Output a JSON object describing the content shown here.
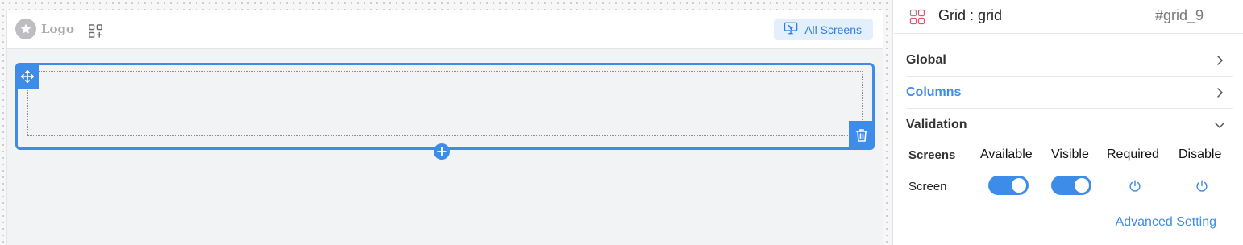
{
  "canvas": {
    "logo_text": "Logo",
    "all_screens_label": "All Screens"
  },
  "panel": {
    "title": "Grid : grid",
    "element_id": "#grid_9",
    "sections": [
      {
        "label": "Global",
        "state": "collapsed",
        "color": "#333333"
      },
      {
        "label": "Columns",
        "state": "collapsed",
        "color": "#3d8ce8"
      },
      {
        "label": "Validation",
        "state": "expanded",
        "color": "#333333"
      }
    ],
    "validation": {
      "headers": [
        "Screens",
        "Available",
        "Visible",
        "Required",
        "Disable"
      ],
      "rows": [
        {
          "screen": "Screen",
          "available": true,
          "visible": true,
          "required": false,
          "disable": false
        }
      ]
    },
    "advanced_setting_label": "Advanced Setting"
  },
  "colors": {
    "accent": "#3d8ce8",
    "accent_light": "#e3effd"
  },
  "icons": {
    "logo": "star-icon",
    "add_widget": "add-widget-icon",
    "all_screens": "monitor-icon",
    "move": "move-icon",
    "delete": "trash-icon",
    "add_row": "plus-icon",
    "grid": "grid-icon",
    "section_collapsed": "chevron-right-icon",
    "section_expanded": "chevron-down-icon",
    "toggle_off": "power-icon"
  }
}
